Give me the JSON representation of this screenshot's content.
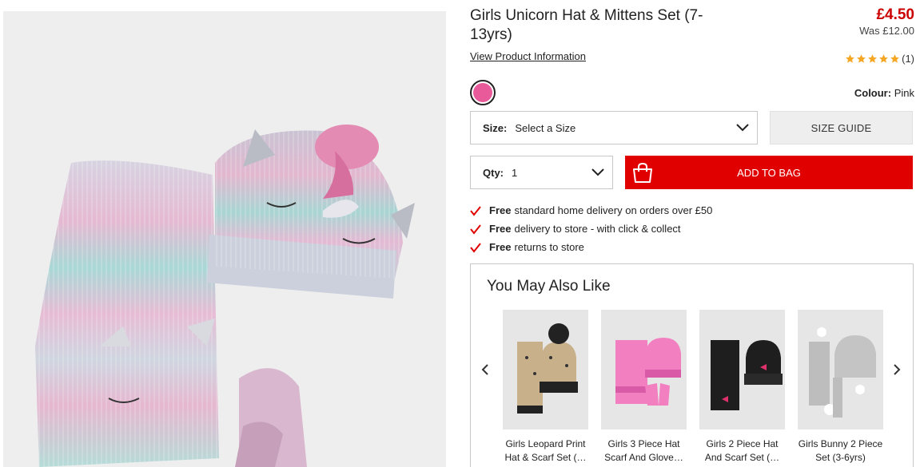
{
  "product": {
    "title": "Girls Unicorn Hat & Mittens Set (7-13yrs)",
    "price": "£4.50",
    "was_price": "Was £12.00",
    "view_info_label": "View Product Information",
    "rating_count": "(1)",
    "rating_value": 5,
    "rating_max": 5,
    "colour_label": "Colour:",
    "colour_value": "Pink",
    "colour_hex": "#e85a9a"
  },
  "size": {
    "label": "Size:",
    "value": "Select a Size"
  },
  "size_guide_label": "SIZE GUIDE",
  "qty": {
    "label": "Qty:",
    "value": "1"
  },
  "add_to_bag_label": "ADD TO BAG",
  "benefits": [
    {
      "bold": "Free",
      "text": "standard home delivery on orders over £50"
    },
    {
      "bold": "Free",
      "text": "delivery to store - with click & collect"
    },
    {
      "bold": "Free",
      "text": "returns to store"
    }
  ],
  "recommendations": {
    "title": "You May Also Like",
    "items": [
      {
        "name": "Girls Leopard Print Hat & Scarf Set (…"
      },
      {
        "name": "Girls 3 Piece Hat Scarf And Glove…"
      },
      {
        "name": "Girls 2 Piece Hat And Scarf Set (…"
      },
      {
        "name": "Girls Bunny 2 Piece Set (3-6yrs)"
      }
    ]
  },
  "colors": {
    "accent": "#e10000",
    "price": "#cc0000",
    "tick": "#e10000",
    "star": "#f5a623"
  }
}
